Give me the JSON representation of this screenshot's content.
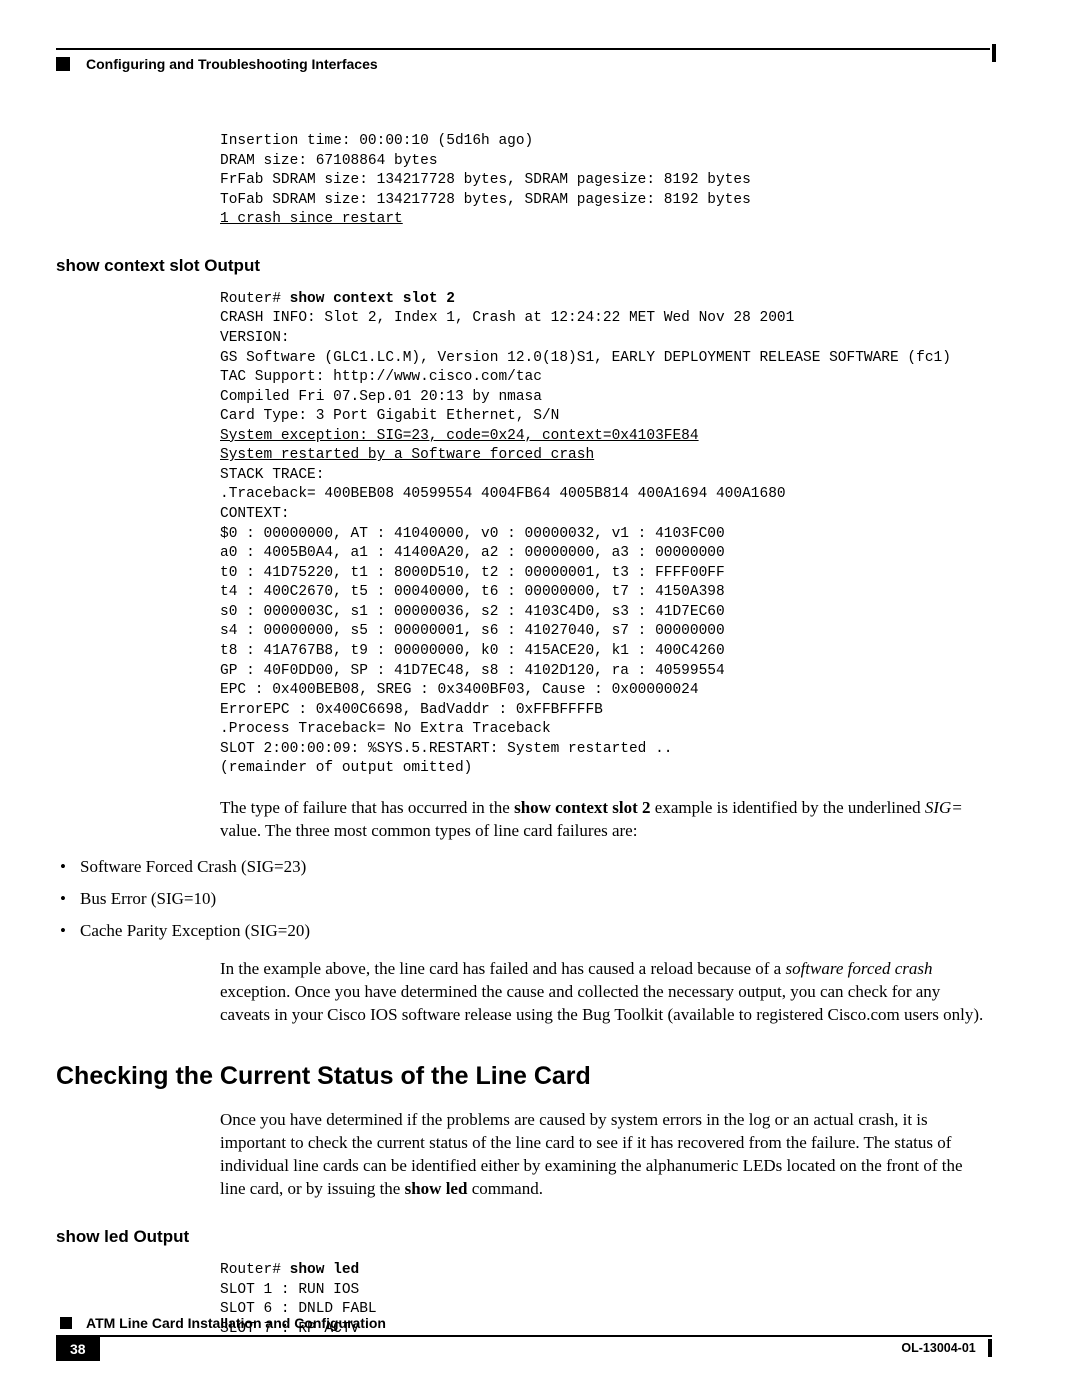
{
  "header": {
    "chapter": "Configuring and Troubleshooting Interfaces"
  },
  "code1": {
    "l1": "Insertion time: 00:00:10 (5d16h ago)",
    "l2": "DRAM size: 67108864 bytes",
    "l3": "FrFab SDRAM size: 134217728 bytes, SDRAM pagesize: 8192 bytes",
    "l4": "ToFab SDRAM size: 134217728 bytes, SDRAM pagesize: 8192 bytes",
    "l5": "1 crash since restart"
  },
  "section1": {
    "heading": "show context slot Output"
  },
  "code2": {
    "prompt": "Router# ",
    "cmd": "show context slot 2",
    "l01": "CRASH INFO: Slot 2, Index 1, Crash at 12:24:22 MET Wed Nov 28 2001",
    "l02": "VERSION:",
    "l03": "GS Software (GLC1.LC.M), Version 12.0(18)S1, EARLY DEPLOYMENT RELEASE SOFTWARE (fc1)",
    "l04": "TAC Support: http://www.cisco.com/tac",
    "l05": "Compiled Fri 07.Sep.01 20:13 by nmasa",
    "l06": "Card Type: 3 Port Gigabit Ethernet, S/N",
    "l07": "System exception: SIG=23, code=0x24, context=0x4103FE84",
    "l08": "System restarted by a Software forced crash",
    "l09": "STACK TRACE:",
    "l10": ".Traceback= 400BEB08 40599554 4004FB64 4005B814 400A1694 400A1680",
    "l11": "CONTEXT:",
    "l12": "$0 : 00000000, AT : 41040000, v0 : 00000032, v1 : 4103FC00",
    "l13": "a0 : 4005B0A4, a1 : 41400A20, a2 : 00000000, a3 : 00000000",
    "l14": "t0 : 41D75220, t1 : 8000D510, t2 : 00000001, t3 : FFFF00FF",
    "l15": "t4 : 400C2670, t5 : 00040000, t6 : 00000000, t7 : 4150A398",
    "l16": "s0 : 0000003C, s1 : 00000036, s2 : 4103C4D0, s3 : 41D7EC60",
    "l17": "s4 : 00000000, s5 : 00000001, s6 : 41027040, s7 : 00000000",
    "l18": "t8 : 41A767B8, t9 : 00000000, k0 : 415ACE20, k1 : 400C4260",
    "l19": "GP : 40F0DD00, SP : 41D7EC48, s8 : 4102D120, ra : 40599554",
    "l20": "EPC : 0x400BEB08, SREG : 0x3400BF03, Cause : 0x00000024",
    "l21": "ErrorEPC : 0x400C6698, BadVaddr : 0xFFBFFFFB",
    "l22": ".Process Traceback= No Extra Traceback",
    "l23": "SLOT 2:00:00:09: %SYS.5.RESTART: System restarted ..",
    "l24": "(remainder of output omitted)"
  },
  "para1": {
    "t1": "The type of failure that has occurred in the ",
    "b1": "show context slot 2",
    "t2": " example is identified by the underlined ",
    "i1": "SIG=",
    "t3": " value. The three most common types of line card failures are:"
  },
  "bullets": {
    "b1": "Software Forced Crash (SIG=23)",
    "b2": "Bus Error (SIG=10)",
    "b3": "Cache Parity Exception (SIG=20)"
  },
  "para2": {
    "t1": "In the example above, the line card has failed and has caused a reload because of a ",
    "i1": "software forced crash",
    "t2": " exception. Once you have determined the cause and collected the necessary output, you can check for any caveats in your Cisco IOS software release using the Bug Toolkit (available to registered Cisco.com users only)."
  },
  "section2": {
    "heading": "Checking the Current Status of the Line Card"
  },
  "para3": {
    "t1": "Once you have determined if the problems are caused by system errors in the log or an actual crash, it is important to check the current status of the line card to see if it has recovered from the failure. The status of individual line cards can be identified either by examining the alphanumeric LEDs located on the front of the line card, or by issuing the ",
    "b1": "show led",
    "t2": " command."
  },
  "section3": {
    "heading": "show led Output"
  },
  "code3": {
    "prompt": "Router# ",
    "cmd": "show led",
    "l1": "SLOT 1 : RUN IOS",
    "l2": "SLOT 6 : DNLD FABL",
    "l3": "SLOT 7 : RP ACTV"
  },
  "footer": {
    "docTitle": "ATM Line Card Installation and Configuration",
    "pageNum": "38",
    "docId": "OL-13004-01"
  }
}
